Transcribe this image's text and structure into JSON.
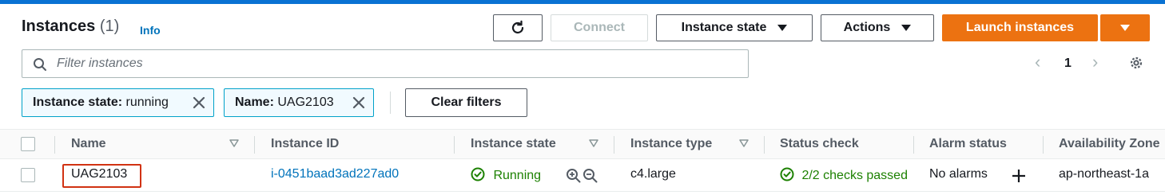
{
  "header": {
    "title": "Instances",
    "count": "(1)",
    "info": "Info"
  },
  "toolbar": {
    "connect": "Connect",
    "instance_state": "Instance state",
    "actions": "Actions",
    "launch": "Launch instances"
  },
  "search": {
    "placeholder": "Filter instances"
  },
  "pagination": {
    "current_page": "1"
  },
  "filters": {
    "tokens": [
      {
        "key": "Instance state:",
        "value": "running"
      },
      {
        "key": "Name:",
        "value": "UAG2103"
      }
    ],
    "clear": "Clear filters"
  },
  "table": {
    "columns": [
      "Name",
      "Instance ID",
      "Instance state",
      "Instance type",
      "Status check",
      "Alarm status",
      "Availability Zone"
    ],
    "rows": [
      {
        "name": "UAG2103",
        "instance_id": "i-0451baad3ad227ad0",
        "state": "Running",
        "type": "c4.large",
        "status_check": "2/2 checks passed",
        "alarm": "No alarms",
        "az": "ap-northeast-1a"
      }
    ]
  },
  "colors": {
    "accent": "#ec7211",
    "link": "#0073bb",
    "success": "#1d8102",
    "filter_border": "#00a1c9",
    "highlight": "#d13212"
  }
}
